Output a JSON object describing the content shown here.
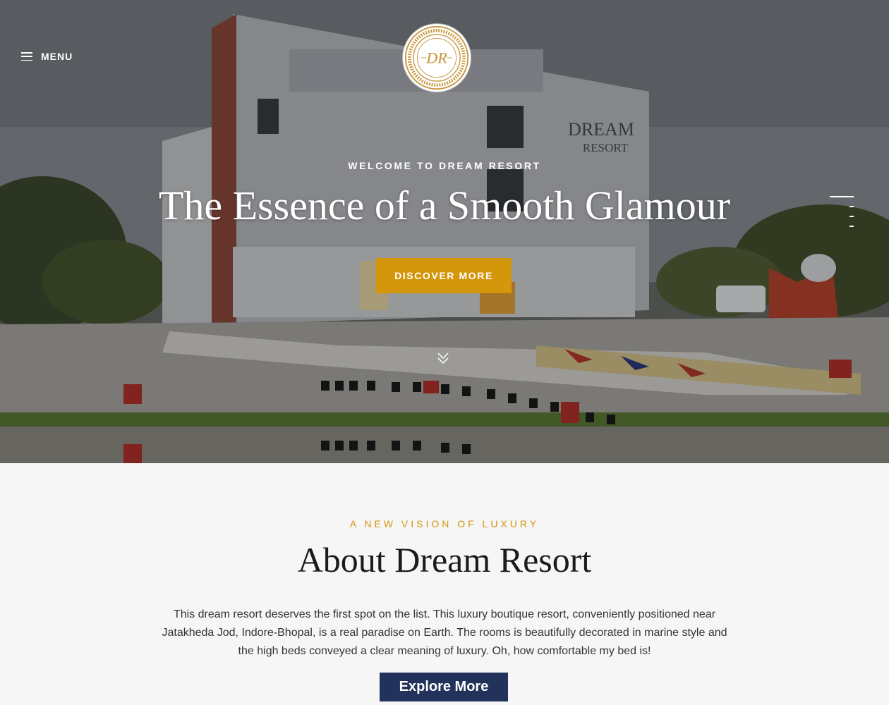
{
  "nav": {
    "menu_label": "MENU",
    "logo_text": "DR"
  },
  "hero": {
    "kicker": "WELCOME TO DREAM RESORT",
    "title": "The Essence of a Smooth Glamour",
    "cta_label": "DISCOVER MORE",
    "building_sign_line1": "DREAM",
    "building_sign_line2": "RESORT",
    "slides_count": 3,
    "active_slide": 1
  },
  "about": {
    "kicker": "A NEW VISION OF LUXURY",
    "title": "About Dream Resort",
    "text": "This dream resort deserves the first spot on the list. This luxury boutique resort, conveniently positioned near Jatakheda Jod, Indore-Bhopal, is a real paradise on Earth. The rooms is beautifully decorated in marine style and the high beds conveyed a clear meaning of luxury. Oh, how comfortable my bed is!",
    "cta_label": "Explore More"
  },
  "colors": {
    "accent_gold": "#d4960a",
    "button_navy": "#22325a",
    "background": "#f6f6f6"
  },
  "icons": [
    "hamburger-icon",
    "double-chevron-down-icon",
    "logo-emblem"
  ]
}
